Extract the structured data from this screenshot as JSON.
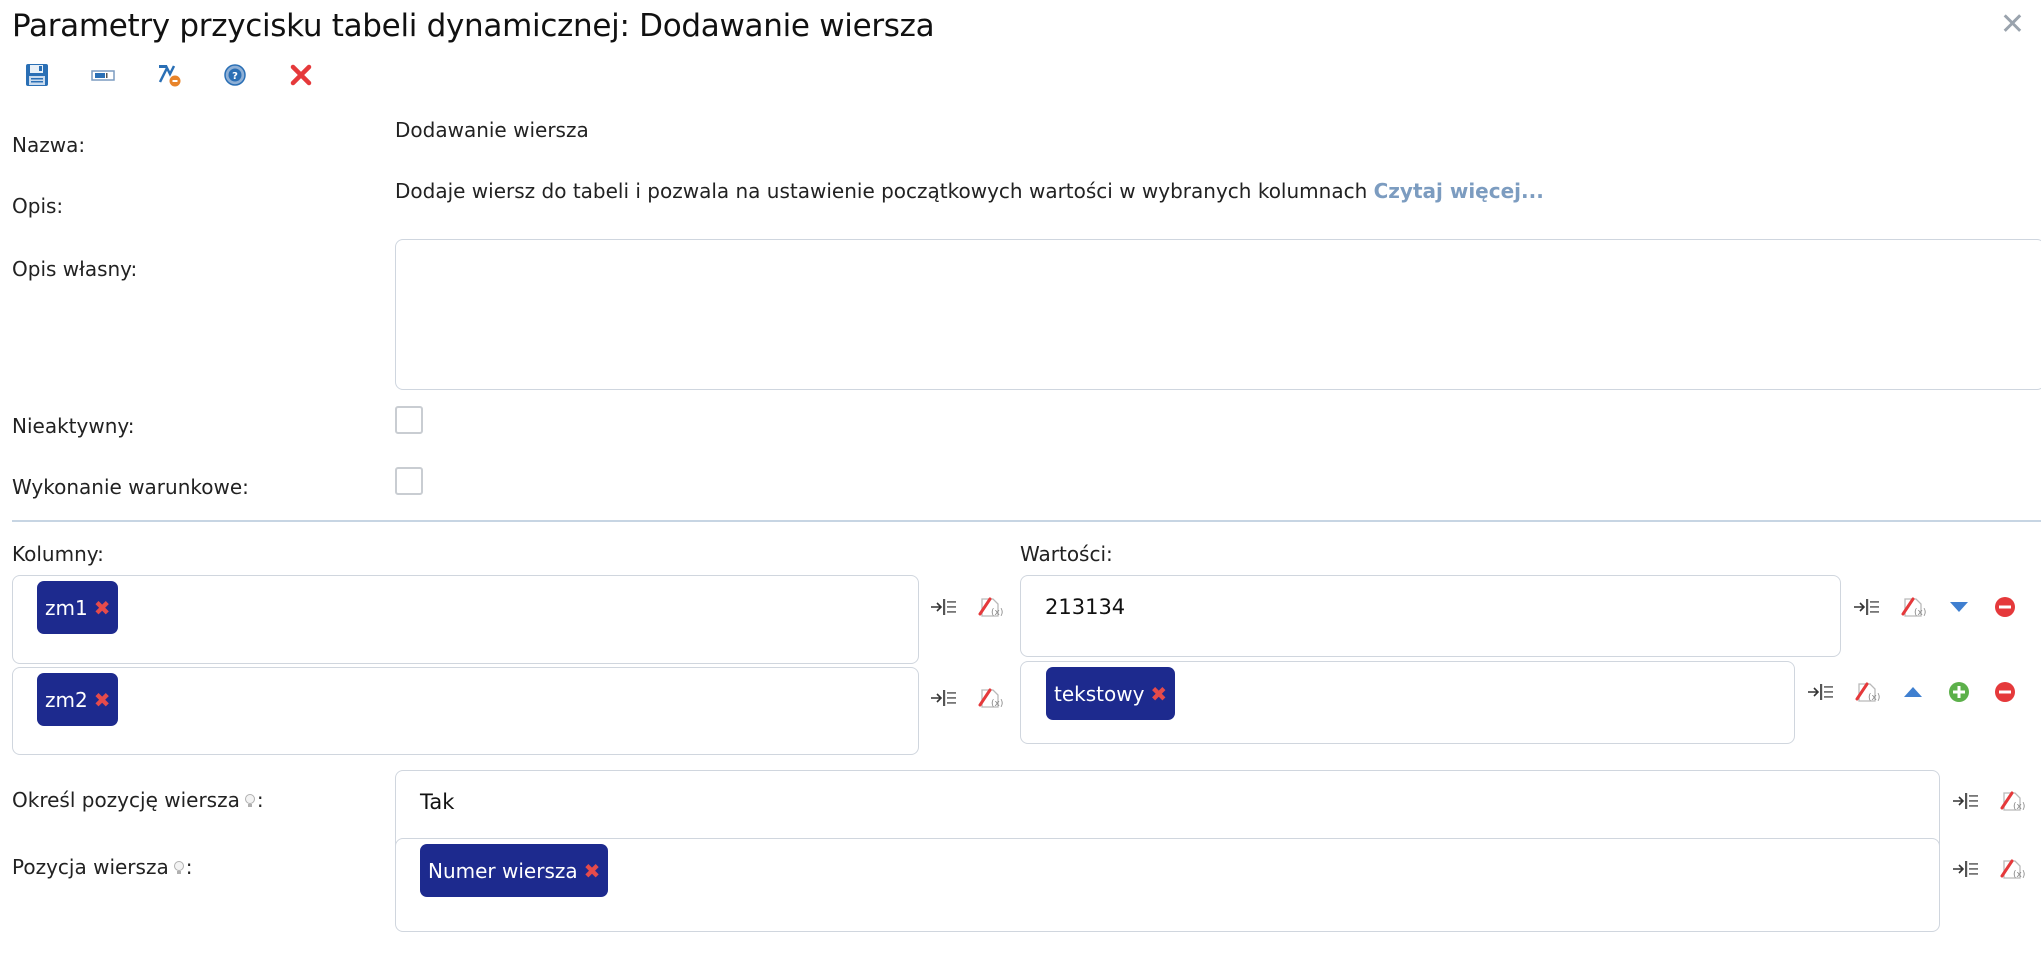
{
  "dialog": {
    "title": "Parametry przycisku tabeli dynamicznej: Dodawanie wiersza",
    "close_glyph": "✕"
  },
  "toolbar": {
    "icons": [
      "save-icon",
      "form-field-icon",
      "test-icon",
      "help-icon",
      "cancel-icon"
    ]
  },
  "form": {
    "name_label": "Nazwa:",
    "name_value": "Dodawanie wiersza",
    "desc_label": "Opis:",
    "desc_value": "Dodaje wiersz do tabeli i pozwala na ustawienie początkowych wartości w wybranych kolumnach",
    "desc_link": "Czytaj więcej...",
    "custom_desc_label": "Opis własny:",
    "custom_desc_value": "",
    "inactive_label": "Nieaktywny:",
    "inactive_checked": false,
    "conditional_label": "Wykonanie warunkowe:",
    "conditional_checked": false
  },
  "columns": {
    "label": "Kolumny:",
    "rows": [
      {
        "tag": "zm1"
      },
      {
        "tag": "zm2"
      }
    ]
  },
  "values": {
    "label": "Wartości:",
    "rows": [
      {
        "text": "213134"
      },
      {
        "tag": "tekstowy"
      }
    ]
  },
  "position_mode": {
    "label": "Określ pozycję wiersza",
    "label_suffix": ":",
    "value": "Tak"
  },
  "position": {
    "label": "Pozycja wiersza",
    "label_suffix": ":",
    "tag": "Numer wiersza"
  },
  "tag_remove_glyph": "✖",
  "colors": {
    "tag_bg": "#1d2a8e",
    "remove_red": "#e54b4b",
    "link": "#7c9cc0",
    "separator": "#c7d5e3"
  }
}
